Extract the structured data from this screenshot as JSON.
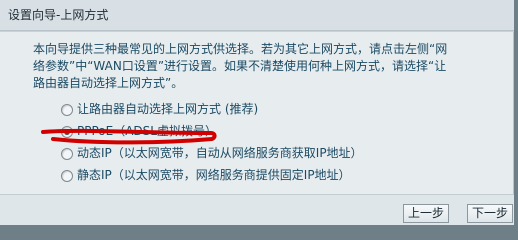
{
  "header": {
    "title": "设置向导-上网方式"
  },
  "intro": {
    "lines": [
      "本向导提供三种最常见的上网方式供选择。若为其它上网方式，请点击左侧“网",
      "络参数”中“WAN口设置”进行设置。如果不清楚使用何种上网方式，请选择“让",
      "路由器自动选择上网方式”。"
    ]
  },
  "options": [
    {
      "label": "让路由器自动选择上网方式 (推荐)",
      "selected": false
    },
    {
      "label": "PPPoE（ADSL虚拟拨号）",
      "selected": true
    },
    {
      "label": "动态IP（以太网宽带，自动从网络服务商获取IP地址）",
      "selected": false
    },
    {
      "label": "静态IP（以太网宽带，网络服务商提供固定IP地址）",
      "selected": false
    }
  ],
  "buttons": {
    "prev": "上一步",
    "next": "下一步"
  },
  "colors": {
    "background": "#6f7f87",
    "panel": "#e7ecef",
    "text": "#1b4a63",
    "annotation": "#d10000"
  }
}
